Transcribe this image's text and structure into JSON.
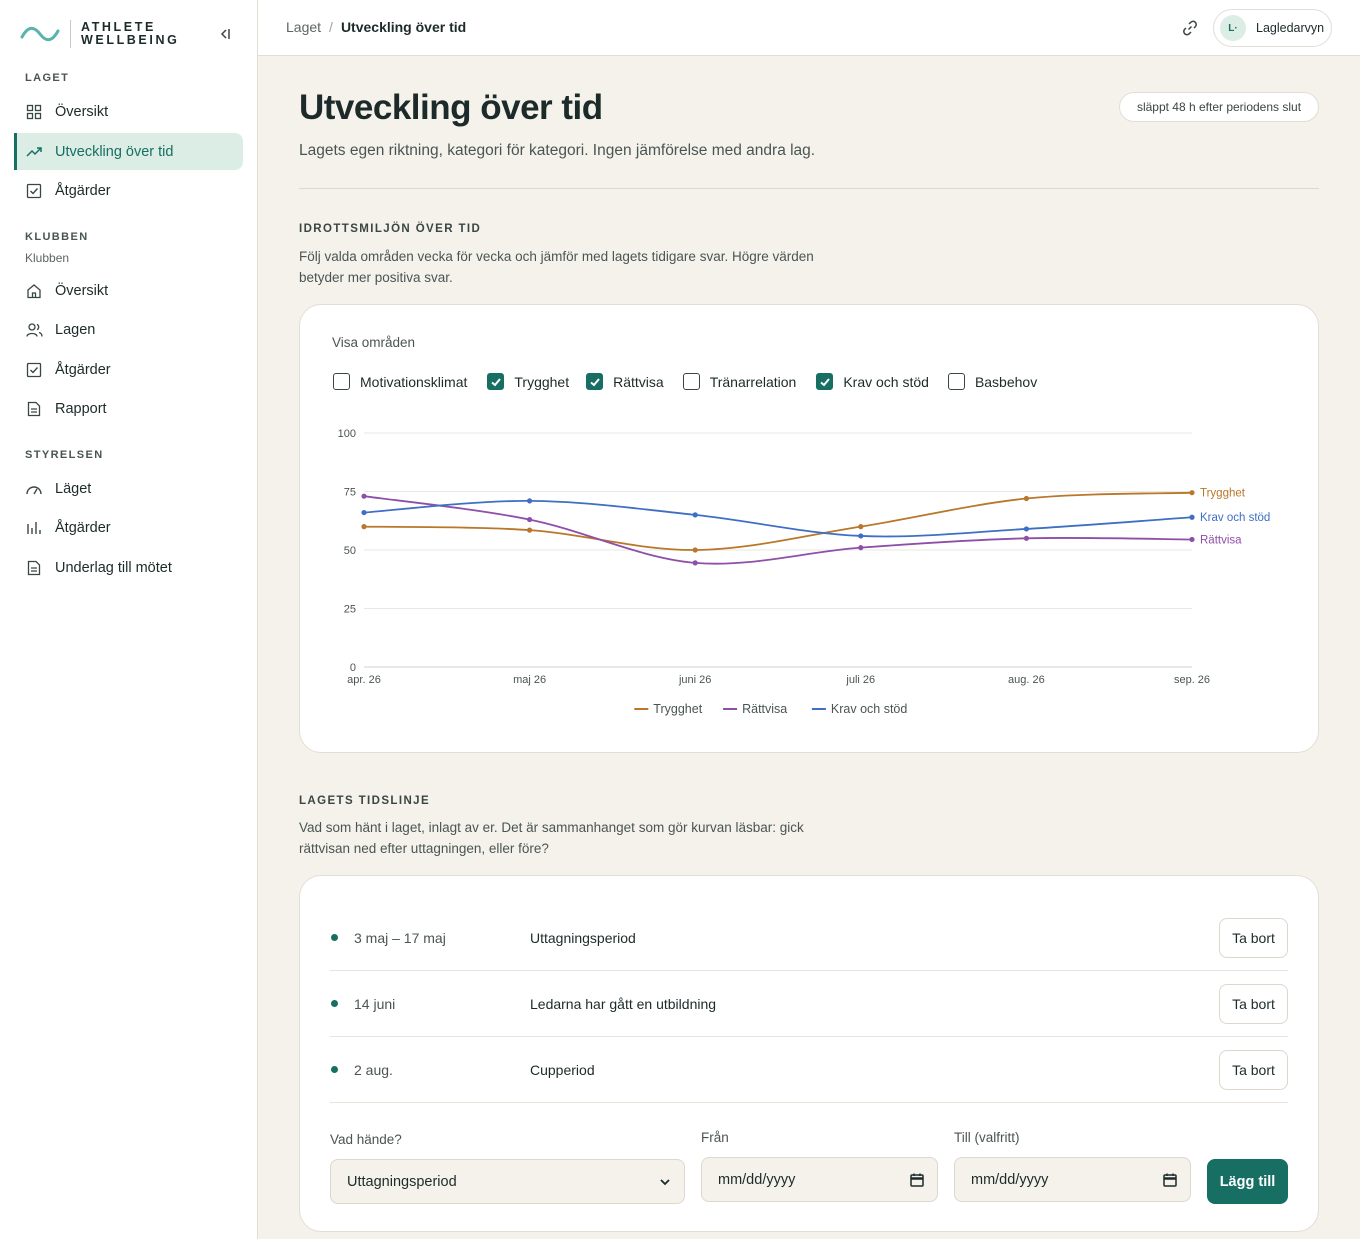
{
  "brand": {
    "line1": "ATHLETE",
    "line2": "WELLBEING",
    "accent": "#176e63"
  },
  "sidebar": {
    "sections": [
      {
        "title": "LAGET",
        "subtitle": "",
        "items": [
          {
            "label": "Översikt",
            "icon": "grid-icon"
          },
          {
            "label": "Utveckling över tid",
            "icon": "trend-up-icon",
            "active": true
          },
          {
            "label": "Åtgärder",
            "icon": "checkbox-icon"
          }
        ]
      },
      {
        "title": "KLUBBEN",
        "subtitle": "Klubben",
        "items": [
          {
            "label": "Översikt",
            "icon": "home-icon"
          },
          {
            "label": "Lagen",
            "icon": "users-icon"
          },
          {
            "label": "Åtgärder",
            "icon": "checkbox-icon"
          },
          {
            "label": "Rapport",
            "icon": "document-icon"
          }
        ]
      },
      {
        "title": "STYRELSEN",
        "subtitle": "",
        "items": [
          {
            "label": "Läget",
            "icon": "gauge-icon"
          },
          {
            "label": "Åtgärder",
            "icon": "bar-chart-icon"
          },
          {
            "label": "Underlag till mötet",
            "icon": "document-icon"
          }
        ]
      }
    ]
  },
  "header": {
    "breadcrumb": [
      "Laget",
      "Utveckling över tid"
    ],
    "user": {
      "initials": "L·",
      "name": "Lagledarvyn"
    }
  },
  "main": {
    "title": "Utveckling över tid",
    "release_badge": "släppt 48 h efter periodens slut",
    "subtitle": "Lagets egen riktning, kategori för kategori. Ingen jämförelse med andra lag."
  },
  "environment_section": {
    "heading": "IDROTTSMILJÖN ÖVER TID",
    "description": "Följ valda områden vecka för vecka och jämför med lagets tidigare svar. Högre värden betyder mer positiva svar.",
    "filter_label": "Visa områden",
    "filters": [
      {
        "label": "Motivationsklimat",
        "checked": false
      },
      {
        "label": "Trygghet",
        "checked": true
      },
      {
        "label": "Rättvisa",
        "checked": true
      },
      {
        "label": "Tränarrelation",
        "checked": false
      },
      {
        "label": "Krav och stöd",
        "checked": true
      },
      {
        "label": "Basbehov",
        "checked": false
      }
    ]
  },
  "chart_data": {
    "type": "line",
    "x": [
      "apr. 26",
      "maj 26",
      "juni 26",
      "juli 26",
      "aug. 26",
      "sep. 26"
    ],
    "ylim": [
      0,
      100
    ],
    "yticks": [
      0,
      25,
      50,
      75,
      100
    ],
    "grid": true,
    "legend": "bottom-center",
    "series": [
      {
        "name": "Trygghet",
        "color": "#b8772a",
        "values": [
          60,
          58.5,
          50,
          60,
          72,
          74.5
        ]
      },
      {
        "name": "Rättvisa",
        "color": "#8e4fa8",
        "values": [
          73,
          63,
          44.5,
          51,
          55,
          54.5
        ]
      },
      {
        "name": "Krav och stöd",
        "color": "#3f6fc4",
        "values": [
          66,
          71,
          65,
          56,
          59,
          64
        ]
      }
    ]
  },
  "timeline_section": {
    "heading": "LAGETS TIDSLINJE",
    "description": "Vad som hänt i laget, inlagt av er. Det är sammanhanget som gör kurvan läsbar: gick rättvisan ned efter uttagningen, eller före?",
    "events": [
      {
        "date": "3 maj – 17 maj",
        "text": "Uttagningsperiod"
      },
      {
        "date": "14 juni",
        "text": "Ledarna har gått en utbildning"
      },
      {
        "date": "2 aug.",
        "text": "Cupperiod"
      }
    ],
    "remove_label": "Ta bort",
    "form": {
      "what_label": "Vad hände?",
      "what_value": "Uttagningsperiod",
      "from_label": "Från",
      "from_placeholder": "mm/dd/yyyy",
      "to_label": "Till (valfritt)",
      "to_placeholder": "mm/dd/yyyy",
      "add_label": "Lägg till"
    }
  }
}
